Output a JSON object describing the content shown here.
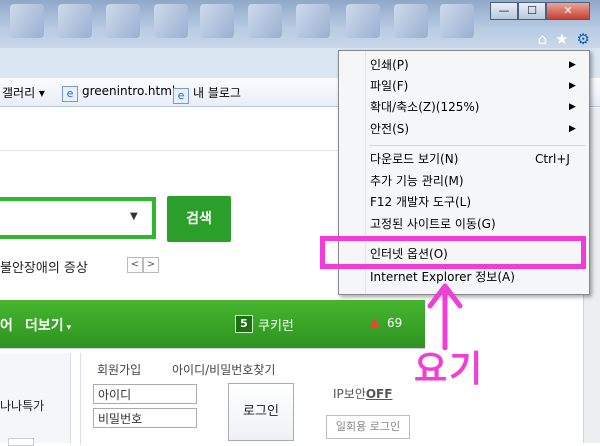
{
  "window": {
    "minimize_label": "—",
    "maximize_label": "☐",
    "close_label": "✕"
  },
  "favorites": {
    "items": [
      {
        "label": "갤러리 ▾"
      },
      {
        "label": "greenintro.html"
      },
      {
        "label": "내 블로그"
      }
    ]
  },
  "page": {
    "search_button": "검색",
    "headline": "불안장애의 증상",
    "pager": [
      "<",
      ">"
    ],
    "nav": {
      "left_text": "어",
      "more": "더보기",
      "badge": "5",
      "cookie": "쿠키런",
      "trend": "69"
    },
    "login": {
      "links": [
        "회원가입",
        "아이디/비밀번호찾기"
      ],
      "id_placeholder": "아이디",
      "pw_placeholder": "비밀번호",
      "login_button": "로그인",
      "ip_security": "IP보안",
      "ip_state": "OFF",
      "one_time_login": "일회용 로그인",
      "side_text": "나나특가"
    }
  },
  "menu": {
    "items": [
      {
        "label": "인쇄(P)",
        "shortcut": "",
        "submenu": true
      },
      {
        "label": "파일(F)",
        "shortcut": "",
        "submenu": true
      },
      {
        "label": "확대/축소(Z)(125%)",
        "shortcut": "",
        "submenu": true
      },
      {
        "label": "안전(S)",
        "shortcut": "",
        "submenu": true
      },
      {
        "label": "다운로드 보기(N)",
        "shortcut": "Ctrl+J",
        "submenu": false
      },
      {
        "label": "추가 기능 관리(M)",
        "shortcut": "",
        "submenu": false
      },
      {
        "label": "F12 개발자 도구(L)",
        "shortcut": "",
        "submenu": false
      },
      {
        "label": "고정된 사이트로 이동(G)",
        "shortcut": "",
        "submenu": false
      },
      {
        "label": "인터넷 옵션(O)",
        "shortcut": "",
        "submenu": false
      },
      {
        "label": "Internet Explorer 정보(A)",
        "shortcut": "",
        "submenu": false
      }
    ]
  },
  "annotation": {
    "text": "요기",
    "highlight_color": "#f13cdb"
  },
  "colors": {
    "brand_green": "#2eb82e",
    "nav_green": "#3aa528"
  }
}
